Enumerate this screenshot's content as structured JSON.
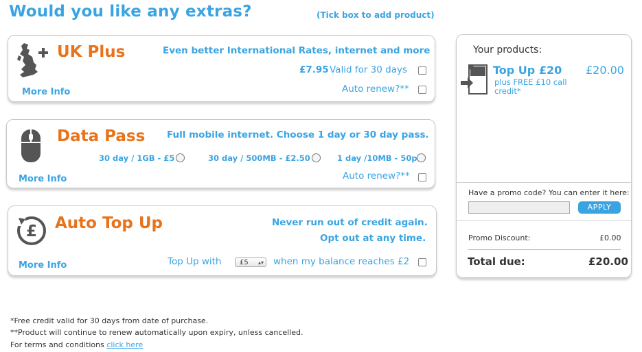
{
  "header": {
    "title": "Would you like any extras?",
    "tick_hint": "(Tick box to add product)"
  },
  "uk_plus": {
    "title": "UK Plus",
    "tagline": "Even better International Rates, internet and more",
    "price": "£7.95",
    "validity": "Valid for 30 days",
    "auto_renew": "Auto renew?**",
    "more_info": "More Info"
  },
  "data_pass": {
    "title": "Data Pass",
    "tagline": "Full mobile internet. Choose 1 day or 30 day pass.",
    "options": [
      "30 day / 1GB - £5",
      "30 day / 500MB - £2.50",
      "1 day /10MB - 50p"
    ],
    "auto_renew": "Auto renew?**",
    "more_info": "More Info"
  },
  "auto_top_up": {
    "title": "Auto Top Up",
    "line1": "Never run out of credit again.",
    "line2": "Opt out at any time.",
    "topup_prefix": "Top Up with",
    "topup_amount": "£5",
    "topup_suffix": "when my balance reaches £2",
    "more_info": "More Info"
  },
  "products": {
    "heading": "Your products:",
    "item_title": "Top Up £20",
    "item_price": "£20.00",
    "item_sub": "plus FREE £10 call credit*",
    "promo_label": "Have a promo code? You can enter it here:",
    "apply_label": "APPLY",
    "promo_discount_label": "Promo Discount:",
    "promo_discount_value": "£0.00",
    "total_label": "Total due:",
    "total_value": "£20.00"
  },
  "footer": {
    "note1": "*Free credit valid for 30 days from date of purchase.",
    "note2": "**Product will continue to renew automatically upon expiry, unless cancelled.",
    "terms_prefix": "For terms and conditions",
    "terms_link": "click here"
  },
  "colors": {
    "accent_blue": "#3aa4e2",
    "accent_orange": "#e8731a"
  },
  "icons": [
    "uk-map-plus-icon",
    "mouse-icon",
    "pound-refresh-icon",
    "sim-card-arrow-icon"
  ]
}
